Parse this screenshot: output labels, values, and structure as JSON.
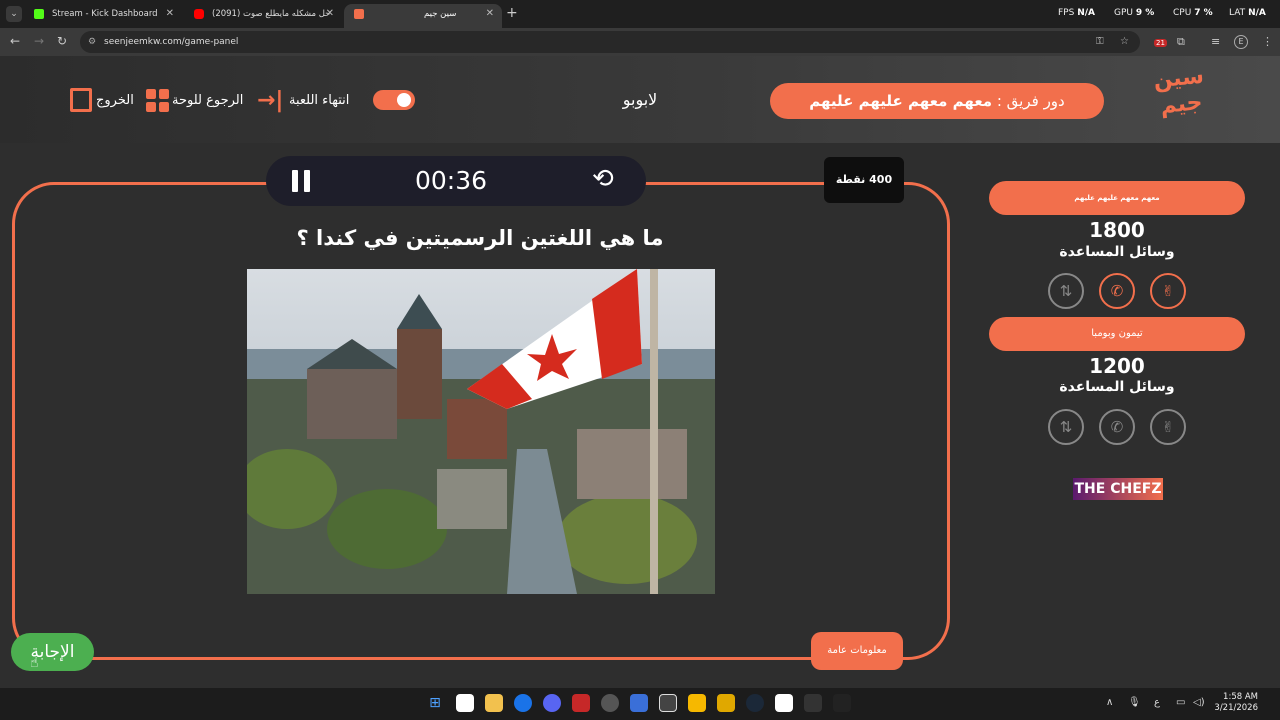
{
  "browser": {
    "tabs": [
      {
        "title": "Stream - Kick Dashboard",
        "favicon_color": "#53fc18"
      },
      {
        "title": "(2091) حل مشكله مايطلع صوت",
        "favicon_color": "#ff0000"
      },
      {
        "title": "سين جيم",
        "favicon_color": "#f26f4c",
        "active": true
      }
    ],
    "new_tab": "+",
    "perf": {
      "fps_label": "FPS",
      "fps_value": "N/A",
      "gpu_label": "GPU",
      "gpu_value": "9 %",
      "cpu_label": "CPU",
      "cpu_value": "7 %",
      "lat_label": "LAT",
      "lat_value": "N/A"
    },
    "url": "seenjeemkw.com/game-panel",
    "extension_badge": "21",
    "profile_initial": "E"
  },
  "header": {
    "logo_text": "سين جيم",
    "turn_prefix": "دور فريق : ",
    "turn_team": "معهم معهم عليهم عليهم",
    "center_title": "لابوبو",
    "end_game": "انتهاء اللعبة",
    "back_to_board": "الرجوع للوحة",
    "exit": "الخروج"
  },
  "game": {
    "timer": "00:36",
    "points": "400 نقطة",
    "question": "ما هي اللغتين الرسميتين في كندا ؟",
    "category": "معلومات عامة",
    "answer_button": "الإجابة"
  },
  "teams": [
    {
      "name": "معهم معهم عليهم عليهم",
      "score": "1800",
      "helpers_label": "وسائل المساعدة",
      "helpers_active": true
    },
    {
      "name": "تيمون وبومبا",
      "score": "1200",
      "helpers_label": "وسائل المساعدة",
      "helpers_active": false
    }
  ],
  "sponsor": "THE CHEFZ",
  "taskbar": {
    "lang": "ع",
    "time": "1:58 AM",
    "date": "3/21/2026"
  },
  "colors": {
    "accent": "#f26f4c",
    "answer": "#4caf50"
  }
}
